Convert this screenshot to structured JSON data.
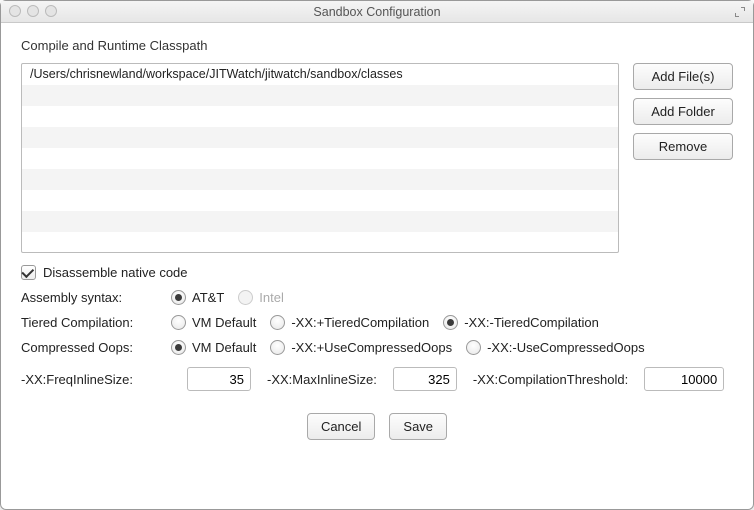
{
  "window": {
    "title": "Sandbox Configuration"
  },
  "classpath": {
    "label": "Compile and Runtime Classpath",
    "entries": [
      "/Users/chrisnewland/workspace/JITWatch/jitwatch/sandbox/classes",
      "",
      "",
      "",
      "",
      "",
      "",
      "",
      ""
    ],
    "buttons": {
      "add_files": "Add File(s)",
      "add_folder": "Add Folder",
      "remove": "Remove"
    }
  },
  "disassemble": {
    "label": "Disassemble native code",
    "checked": true
  },
  "assembly_syntax": {
    "label": "Assembly syntax:",
    "options": {
      "att": "AT&T",
      "intel": "Intel"
    },
    "selected": "att",
    "intel_enabled": false
  },
  "tiered": {
    "label": "Tiered Compilation:",
    "options": {
      "default": "VM Default",
      "on": "-XX:+TieredCompilation",
      "off": "-XX:-TieredCompilation"
    },
    "selected": "off"
  },
  "compressed_oops": {
    "label": "Compressed Oops:",
    "options": {
      "default": "VM Default",
      "on": "-XX:+UseCompressedOops",
      "off": "-XX:-UseCompressedOops"
    },
    "selected": "default"
  },
  "inline": {
    "freq_label": "-XX:FreqInlineSize:",
    "freq_value": "35",
    "max_label": "-XX:MaxInlineSize:",
    "max_value": "325",
    "threshold_label": "-XX:CompilationThreshold:",
    "threshold_value": "10000"
  },
  "footer": {
    "cancel": "Cancel",
    "save": "Save"
  }
}
